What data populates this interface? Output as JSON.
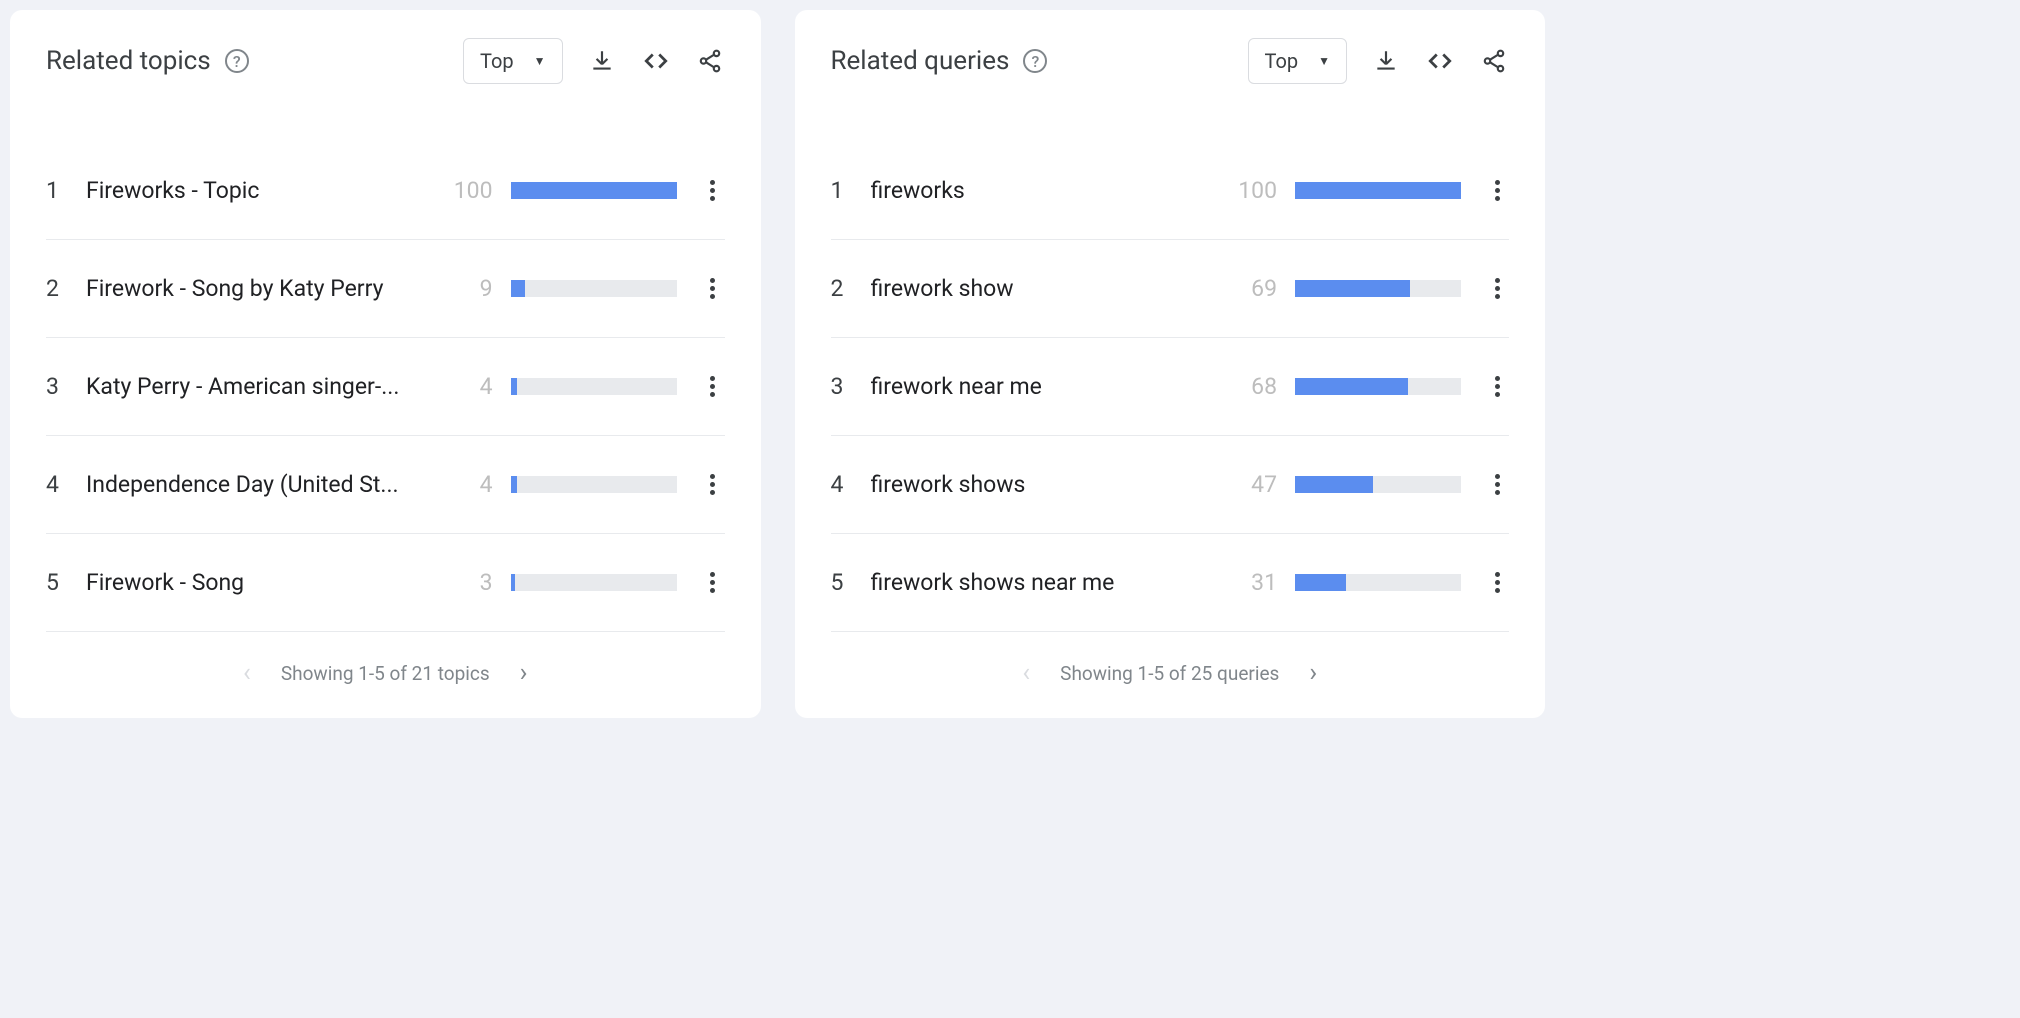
{
  "panels": [
    {
      "title": "Related topics",
      "dropdown": "Top",
      "items": [
        {
          "rank": "1",
          "label": "Fireworks - Topic",
          "value": "100",
          "pct": 100
        },
        {
          "rank": "2",
          "label": "Firework - Song by Katy Perry",
          "value": "9",
          "pct": 9
        },
        {
          "rank": "3",
          "label": "Katy Perry - American singer-...",
          "value": "4",
          "pct": 4
        },
        {
          "rank": "4",
          "label": "Independence Day (United St...",
          "value": "4",
          "pct": 4
        },
        {
          "rank": "5",
          "label": "Firework - Song",
          "value": "3",
          "pct": 3
        }
      ],
      "footer": "Showing 1-5 of 21 topics"
    },
    {
      "title": "Related queries",
      "dropdown": "Top",
      "items": [
        {
          "rank": "1",
          "label": "fireworks",
          "value": "100",
          "pct": 100
        },
        {
          "rank": "2",
          "label": "firework show",
          "value": "69",
          "pct": 69
        },
        {
          "rank": "3",
          "label": "firework near me",
          "value": "68",
          "pct": 68
        },
        {
          "rank": "4",
          "label": "firework shows",
          "value": "47",
          "pct": 47
        },
        {
          "rank": "5",
          "label": "firework shows near me",
          "value": "31",
          "pct": 31
        }
      ],
      "footer": "Showing 1-5 of 25 queries"
    }
  ],
  "chart_data": [
    {
      "type": "bar",
      "title": "Related topics",
      "categories": [
        "Fireworks - Topic",
        "Firework - Song by Katy Perry",
        "Katy Perry - American singer-...",
        "Independence Day (United St...",
        "Firework - Song"
      ],
      "values": [
        100,
        9,
        4,
        4,
        3
      ],
      "xlabel": "",
      "ylabel": "",
      "ylim": [
        0,
        100
      ]
    },
    {
      "type": "bar",
      "title": "Related queries",
      "categories": [
        "fireworks",
        "firework show",
        "firework near me",
        "firework shows",
        "firework shows near me"
      ],
      "values": [
        100,
        69,
        68,
        47,
        31
      ],
      "xlabel": "",
      "ylabel": "",
      "ylim": [
        0,
        100
      ]
    }
  ]
}
